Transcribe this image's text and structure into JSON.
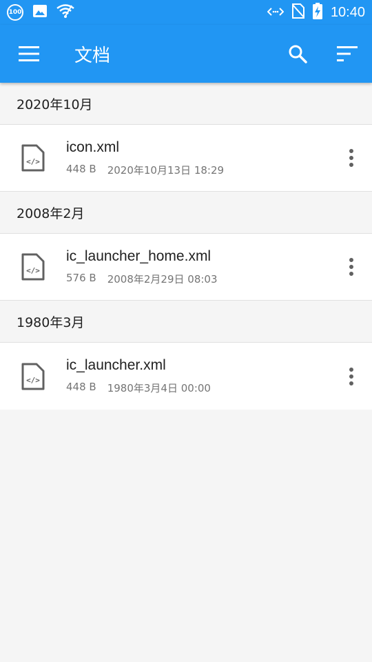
{
  "status_bar": {
    "battery_badge": "100",
    "time": "10:40",
    "icons": [
      "battery-saver-badge-icon",
      "image-icon",
      "wifi-icon",
      "data-arrows-icon",
      "no-sim-icon",
      "battery-charging-icon"
    ]
  },
  "app_bar": {
    "title": "文档",
    "icons": [
      "menu-icon",
      "search-icon",
      "sort-icon"
    ]
  },
  "sections": [
    {
      "header": "2020年10月",
      "files": [
        {
          "name": "icon.xml",
          "size": "448 B",
          "date": "2020年10月13日 18:29"
        }
      ]
    },
    {
      "header": "2008年2月",
      "files": [
        {
          "name": "ic_launcher_home.xml",
          "size": "576 B",
          "date": "2008年2月29日 08:03"
        }
      ]
    },
    {
      "header": "1980年3月",
      "files": [
        {
          "name": "ic_launcher.xml",
          "size": "448 B",
          "date": "1980年3月4日 00:00"
        }
      ]
    }
  ],
  "colors": {
    "primary": "#2196f3",
    "background": "#f5f5f5",
    "secondary_text": "#757575",
    "icon_grey": "#616161"
  }
}
